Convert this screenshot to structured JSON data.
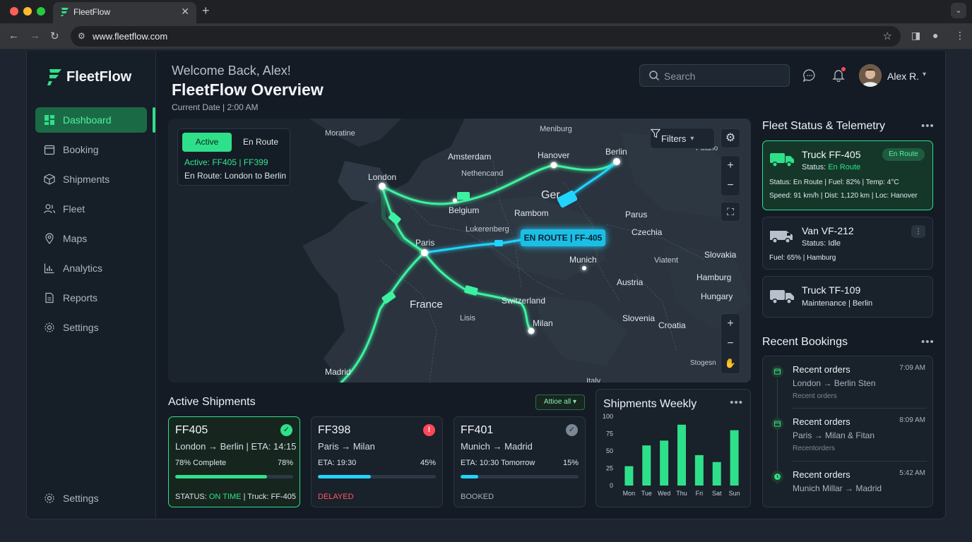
{
  "browser": {
    "tab_title": "FleetFlow",
    "url": "www.fleetflow.com"
  },
  "colors": {
    "accent": "#2fe08a",
    "cyan": "#21d3ff",
    "danger": "#ff4757",
    "bg": "#141b24"
  },
  "sidebar": {
    "brand": "FleetFlow",
    "items": [
      {
        "label": "Dashboard",
        "icon": "grid-icon"
      },
      {
        "label": "Booking",
        "icon": "calendar-icon"
      },
      {
        "label": "Shipments",
        "icon": "box-icon"
      },
      {
        "label": "Fleet",
        "icon": "users-icon"
      },
      {
        "label": "Maps",
        "icon": "pin-icon"
      },
      {
        "label": "Analytics",
        "icon": "chart-icon"
      },
      {
        "label": "Reports",
        "icon": "document-icon"
      },
      {
        "label": "Settings",
        "icon": "gear-icon"
      }
    ],
    "footer_settings": "Settings"
  },
  "header": {
    "welcome": "Welcome Back, Alex!",
    "title": "FleetFlow Overview",
    "date": "Current Date | 2:00 AM",
    "search_placeholder": "Search",
    "user_name": "Alex R."
  },
  "map": {
    "toggle_active": "Active",
    "toggle_enroute": "En Route",
    "active_line": "Active: FF405   |   FF399",
    "enroute_line": "En Route: London to Berlin",
    "filters": "Filters",
    "callout": "EN ROUTE | FF-405",
    "cities": [
      "Moratine",
      "Meniburg",
      "Amsterdam",
      "Hanover",
      "Berlin",
      "Pulano",
      "Nethencand",
      "London",
      "Ger",
      "Belgium",
      "Rambom",
      "Parus",
      "Lukerenberg",
      "Czechia",
      "Paris",
      "Munich",
      "Slovakia",
      "Viatent",
      "Hamburg",
      "Austria",
      "Hungary",
      "France",
      "Switzerland",
      "Lisis",
      "Slovenia",
      "Croatia",
      "Milan",
      "Madrid",
      "Stogesn",
      "Italy"
    ]
  },
  "active_shipments": {
    "title": "Active Shipments",
    "filter_label": "Attioe all",
    "cards": [
      {
        "id": "FF405",
        "route": "London → Berlin | ETA: 14:15",
        "left": "78% Complete",
        "right": "78%",
        "progress": 0.78,
        "status_prefix": "STATUS: ",
        "status": "ON TIME",
        "status_suffix": " | Truck: FF-405"
      },
      {
        "id": "FF398",
        "route": "Paris → Milan",
        "left": "ETA: 19:30",
        "right": "45%",
        "progress": 0.45,
        "status_prefix": "",
        "status": "DELAYED",
        "status_suffix": ""
      },
      {
        "id": "FF401",
        "route": "Munich → Madrid",
        "left": "ETA: 10:30 Tomorrow",
        "right": "15%",
        "progress": 0.15,
        "status_prefix": "",
        "status": "BOOKED",
        "status_suffix": ""
      }
    ]
  },
  "chart_data": {
    "type": "bar",
    "title": "Shipments Weekly",
    "categories": [
      "Mon",
      "Tue",
      "Wed",
      "Thu",
      "Fri",
      "Sat",
      "Sun"
    ],
    "values": [
      28,
      58,
      65,
      88,
      44,
      34,
      80
    ],
    "ylim": [
      0,
      100
    ],
    "yticks": [
      0,
      25,
      50,
      75,
      100
    ],
    "grid": false
  },
  "fleet": {
    "title": "Fleet Status & Telemetry",
    "cards": [
      {
        "name": "Truck FF-405",
        "pill": "En Route",
        "status_label": "Status: ",
        "status_value": "En Route",
        "line1": "Status: En Route | Fuel: 82% | Temp: 4°C",
        "line2": "Speed: 91 km/h | Dist: 1,120 km | Loc: Hanover"
      },
      {
        "name": "Van VF-212",
        "status": "Status: Idle",
        "line1": "Fuel: 65% | Hamburg"
      },
      {
        "name": "Truck TF-109",
        "status": "Maintenance | Berlin"
      }
    ]
  },
  "bookings": {
    "title": "Recent Bookings",
    "items": [
      {
        "title": "Recent orders",
        "route": "London → Berlin Sten",
        "sub": "Recent orders",
        "time": "7:09 AM"
      },
      {
        "title": "Recent orders",
        "route": "Paris → Milan & Fitan",
        "sub": "Recentorders",
        "time": "8:09 AM"
      },
      {
        "title": "Recent orders",
        "route": "Munich Millar → Madrid",
        "sub": "",
        "time": "5:42 AM"
      }
    ]
  }
}
